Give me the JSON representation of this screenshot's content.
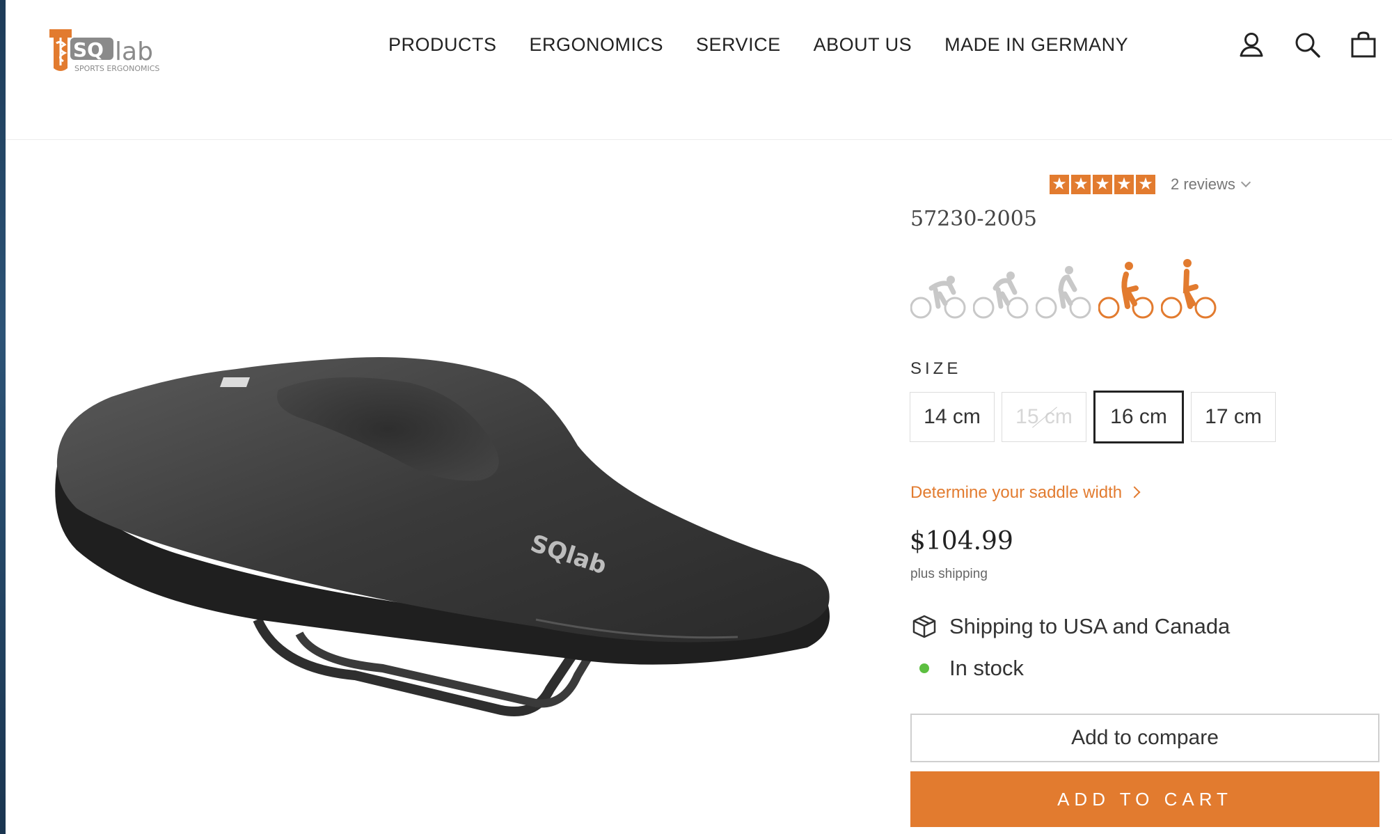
{
  "brand": {
    "logo_text": "SQlab",
    "logo_tagline": "SPORTS ERGONOMICS",
    "accent_color": "#e27b2f"
  },
  "nav": {
    "items": [
      "PRODUCTS",
      "ERGONOMICS",
      "SERVICE",
      "ABOUT US",
      "MADE IN GERMANY"
    ]
  },
  "header_icons": [
    "account-icon",
    "search-icon",
    "cart-icon"
  ],
  "product": {
    "rating": 5,
    "rating_max": 5,
    "reviews_label": "2 reviews",
    "sku": "57230-2005",
    "riding_positions": [
      {
        "icon": "road-aggressive-rider-icon",
        "active": false
      },
      {
        "icon": "road-sport-rider-icon",
        "active": false
      },
      {
        "icon": "touring-rider-icon",
        "active": false
      },
      {
        "icon": "upright-rider-icon",
        "active": true
      },
      {
        "icon": "city-rider-icon",
        "active": true
      }
    ],
    "size_label": "SIZE",
    "sizes": [
      {
        "label": "14 cm",
        "state": "available"
      },
      {
        "label": "15 cm",
        "state": "unavailable"
      },
      {
        "label": "16 cm",
        "state": "selected"
      },
      {
        "label": "17 cm",
        "state": "available"
      }
    ],
    "saddle_width_link": "Determine your saddle width",
    "price": "$104.99",
    "price_note": "plus shipping",
    "shipping_info": "Shipping to USA and Canada",
    "stock_status": "In stock",
    "stock_color": "#5cbf40",
    "compare_label": "Add to compare",
    "cart_label": "ADD TO CART",
    "image_logo_text": "SQlab"
  }
}
